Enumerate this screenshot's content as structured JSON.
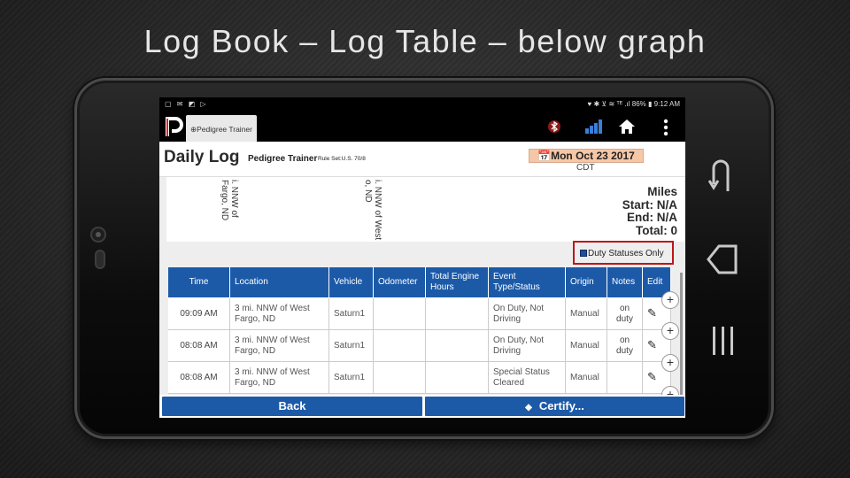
{
  "slide": {
    "title": "Log Book – Log Table – below graph"
  },
  "status_bar": {
    "left_icons": "▢ ✉ ◩ ▷",
    "right_info": "♥ ✱ ⊻ ≋ ᵀᴱ .ıl 86% ▮ 9:12 AM"
  },
  "app_bar": {
    "tab_label": "⊕Pedigree Trainer"
  },
  "header": {
    "title": "Daily Log",
    "driver": "Pedigree Trainer",
    "rule_set": "Rule Set:U.S. 70/8",
    "date": "Mon Oct 23 2017",
    "timezone": "CDT"
  },
  "graph": {
    "location_label_1": "i. NNW of\nFargo, ND",
    "location_label_2": "i. NNW of West\no, ND"
  },
  "miles": {
    "title": "Miles",
    "start": "Start: N/A",
    "end": "End: N/A",
    "total": "Total:   0"
  },
  "filter": {
    "label": "Duty Statuses Only",
    "checked": true
  },
  "table": {
    "headers": [
      "Time",
      "Location",
      "Vehicle",
      "Odometer",
      "Total Engine Hours",
      "Event Type/Status",
      "Origin",
      "Notes",
      "Edit"
    ],
    "rows": [
      {
        "time": "09:09 AM",
        "location": "3 mi. NNW of West Fargo, ND",
        "vehicle": "Saturn1",
        "odometer": "",
        "engine_hours": "",
        "event": "On Duty, Not Driving",
        "origin": "Manual",
        "notes": "on duty"
      },
      {
        "time": "08:08 AM",
        "location": "3 mi. NNW of West Fargo, ND",
        "vehicle": "Saturn1",
        "odometer": "",
        "engine_hours": "",
        "event": "On Duty, Not Driving",
        "origin": "Manual",
        "notes": "on duty"
      },
      {
        "time": "08:08 AM",
        "location": "3 mi. NNW of West Fargo, ND",
        "vehicle": "Saturn1",
        "odometer": "",
        "engine_hours": "",
        "event": "Special Status Cleared",
        "origin": "Manual",
        "notes": ""
      }
    ]
  },
  "buttons": {
    "back": "Back",
    "certify": "Certify..."
  },
  "colors": {
    "accent_blue": "#1c5aa8",
    "highlight_red": "#c0141c",
    "date_bg": "#f6c7a6"
  },
  "icons": [
    "logo-icon",
    "no-bluetooth-icon",
    "signal-icon",
    "home-icon",
    "overflow-menu-icon",
    "pencil-icon",
    "plus-icon",
    "shield-check-icon",
    "back-arrow-icon",
    "back-nav-icon",
    "recents-icon"
  ]
}
